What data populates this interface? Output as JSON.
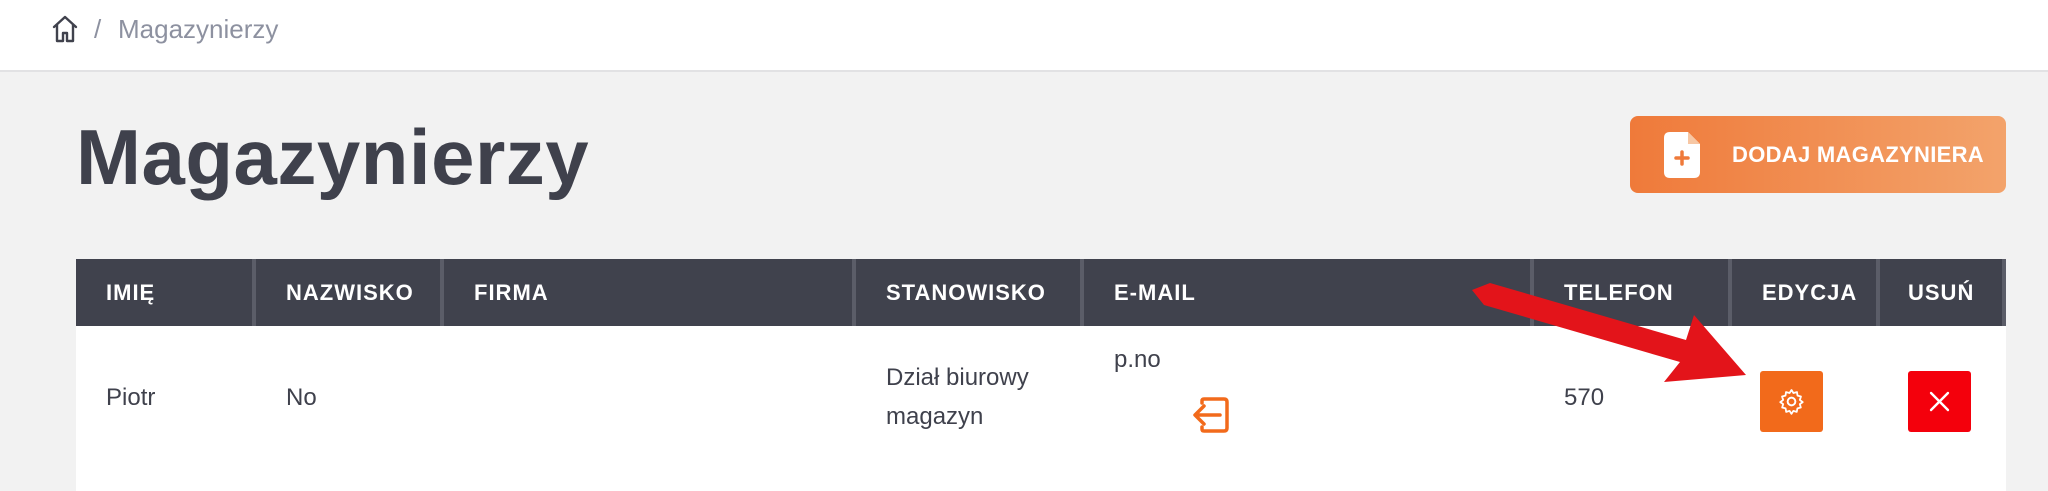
{
  "breadcrumb": {
    "separator": "/",
    "current": "Magazynierzy"
  },
  "page": {
    "title": "Magazynierzy"
  },
  "add_button": {
    "label": "DODAJ MAGAZYNIERA"
  },
  "table": {
    "headers": [
      "IMIĘ",
      "NAZWISKO",
      "FIRMA",
      "STANOWISKO",
      "E-MAIL",
      "TELEFON",
      "EDYCJA",
      "USUŃ"
    ],
    "rows": [
      {
        "first_name": "Piotr",
        "last_name": "No",
        "company": "",
        "position_line1": "Dział biurowy",
        "position_line2": "magazyn",
        "email": "p.no",
        "phone": "570"
      }
    ]
  },
  "icons": {
    "home": "home-icon",
    "add": "document-plus-icon",
    "login": "login-arrow-icon",
    "edit": "gear-icon",
    "delete": "close-icon"
  },
  "colors": {
    "header_bg": "#40424d",
    "accent_orange": "#f26a1b",
    "delete_red": "#f4000c",
    "annotation_arrow": "#e3141a"
  }
}
